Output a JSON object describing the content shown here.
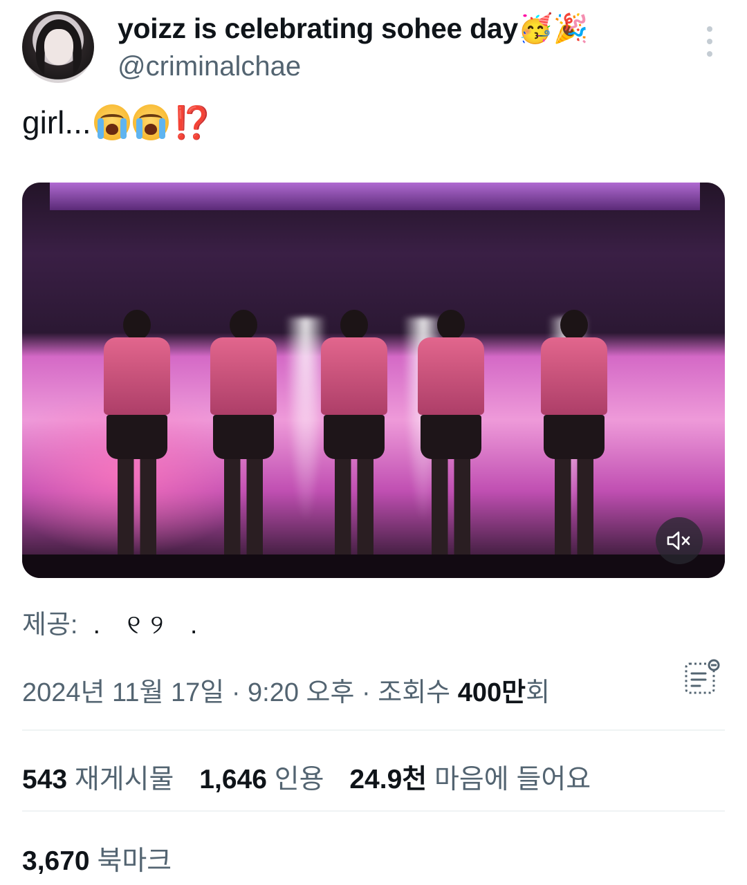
{
  "tweet": {
    "display_name": "yoizz is celebrating sohee day🥳🎉",
    "handle": "@criminalchae",
    "text": "girl...",
    "text_emojis": [
      "loudly-crying-face-emoji",
      "loudly-crying-face-emoji",
      "exclamation-question-mark"
    ],
    "exclamation": "⁉️"
  },
  "media": {
    "type": "video",
    "muted": true,
    "mute_icon": "volume-muted-icon"
  },
  "credit": {
    "label": "제공:",
    "source": ". ୧୨ ."
  },
  "meta": {
    "date": "2024년 11월 17일",
    "separator1": "·",
    "time": "9:20 오후",
    "separator2": "·",
    "views_label": "조회수",
    "views_value": "400만",
    "views_suffix": "회",
    "analytics_icon": "analytics-icon"
  },
  "stats": {
    "reposts": {
      "value": "543",
      "label": "재게시물"
    },
    "quotes": {
      "value": "1,646",
      "label": "인용"
    },
    "likes": {
      "value": "24.9천",
      "label": "마음에 들어요"
    }
  },
  "bookmarks": {
    "value": "3,670",
    "label": "북마크"
  },
  "colors": {
    "text_primary": "#0f1419",
    "text_secondary": "#536471",
    "divider": "#eff3f4",
    "background": "#ffffff"
  }
}
